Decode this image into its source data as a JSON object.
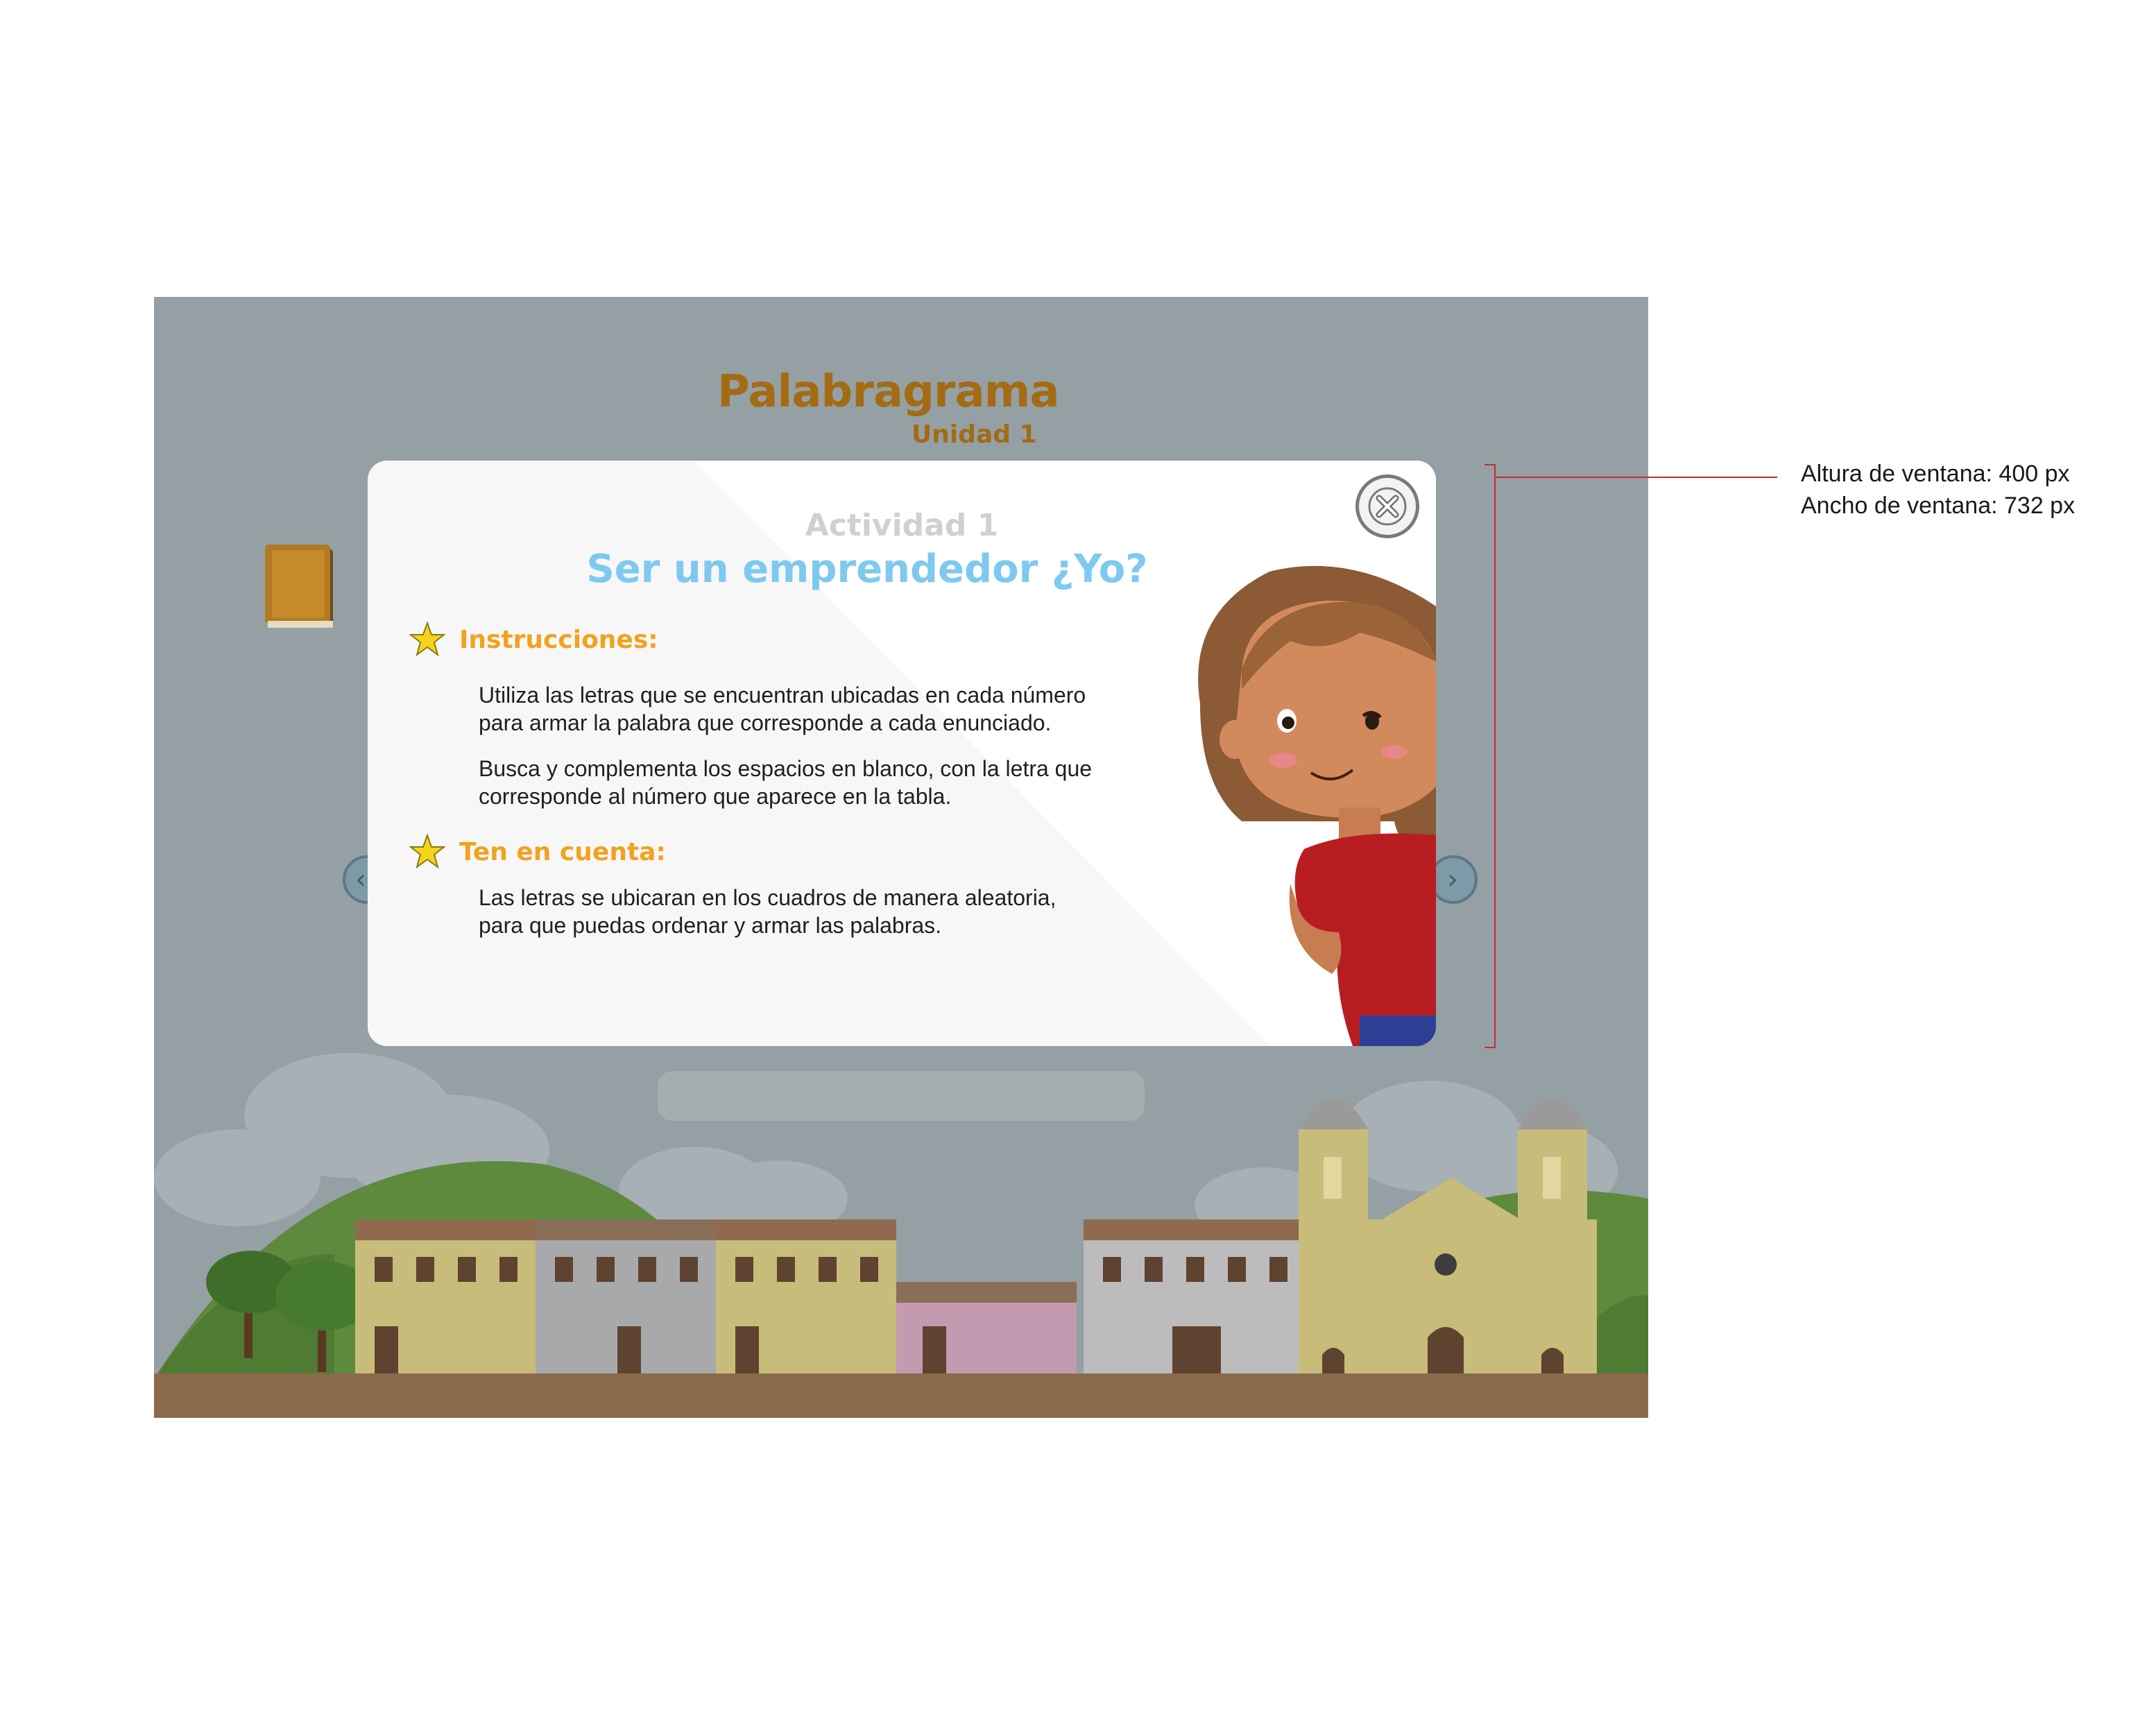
{
  "game": {
    "title": "Palabragrama",
    "subtitle": "Unidad 1"
  },
  "modal": {
    "activity": "Actividad 1",
    "title": "Ser un emprendedor ¿Yo?",
    "instructions_label": "Instrucciones:",
    "instructions_p1_l1": "Utiliza las letras que se encuentran ubicadas en cada número",
    "instructions_p1_l2": "para armar la palabra que corresponde a cada enunciado.",
    "instructions_p2_l1": "Busca y complementa los espacios en blanco, con la letra que",
    "instructions_p2_l2": "corresponde al número que aparece en  la tabla.",
    "note_label": "Ten en cuenta:",
    "note_p_l1": "Las letras se ubicaran en los cuadros de manera aleatoria,",
    "note_p_l2": "para que puedas ordenar y armar las palabras.",
    "close_icon": "close-icon",
    "star_icon": "star-icon"
  },
  "annotation": {
    "height_label": "Altura de ventana: 400 px",
    "width_label": "Ancho de ventana: 732 px",
    "line_color": "#d0282e"
  },
  "colors": {
    "title": "#a46b15",
    "activity_title": "#7ec9ef",
    "section_label": "#f2a21f",
    "background": "#95a0a5"
  }
}
